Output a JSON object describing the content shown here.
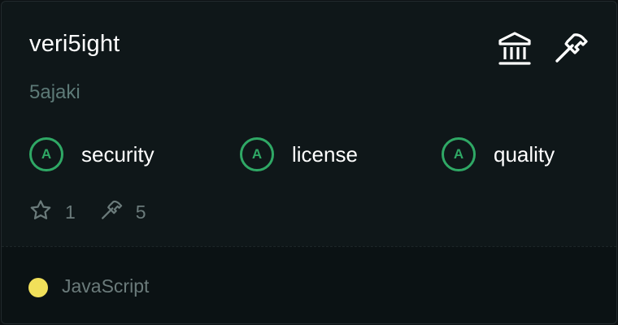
{
  "repo": {
    "name": "veri5ight",
    "owner": "5ajaki"
  },
  "header_icons": [
    "institution-icon",
    "hammer-icon"
  ],
  "grades": [
    {
      "grade": "A",
      "label": "security"
    },
    {
      "grade": "A",
      "label": "license"
    },
    {
      "grade": "A",
      "label": "quality"
    }
  ],
  "stats": {
    "stars": "1",
    "forks": "5"
  },
  "language": {
    "name": "JavaScript",
    "color": "#f1e05a"
  },
  "colors": {
    "grade_accent": "#2fa865",
    "background": "#0f1719"
  }
}
